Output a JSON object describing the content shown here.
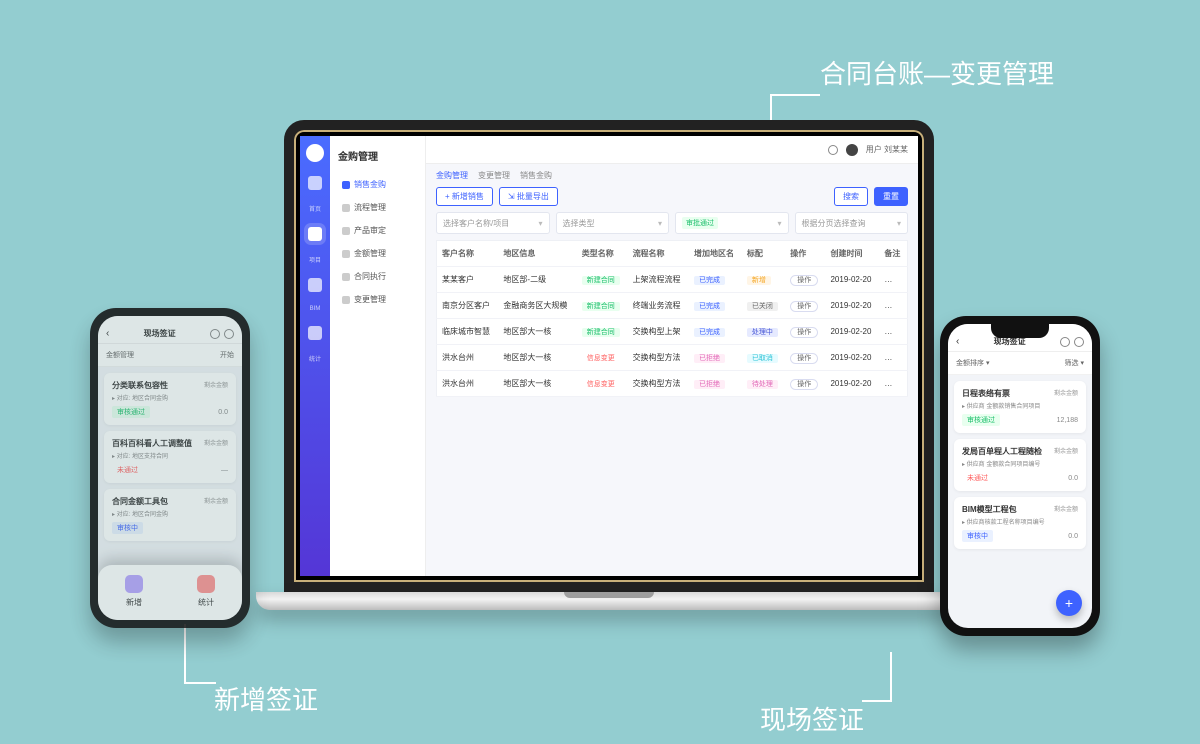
{
  "callouts": {
    "top": "合同台账—变更管理",
    "bottom_left": "新增签证",
    "bottom_right": "现场签证"
  },
  "laptop": {
    "page_title": "金购管理",
    "user_name": "用户 刘某某",
    "iconbar": [
      "首页",
      "项目",
      "BIM",
      "统计"
    ],
    "sidenav": [
      {
        "label": "销售金购",
        "active": true
      },
      {
        "label": "流程管理"
      },
      {
        "label": "产品审定"
      },
      {
        "label": "金额管理"
      },
      {
        "label": "合同执行"
      },
      {
        "label": "变更管理"
      }
    ],
    "crumbs": {
      "a": "金购管理",
      "b": "变更管理",
      "c": "销售金购"
    },
    "actions": {
      "new": "+ 新增销售",
      "export": "⇲ 批量导出",
      "search": "搜索",
      "reset": "重置"
    },
    "filters": {
      "f1": "选择客户名称/项目",
      "f2": "选择类型",
      "f3_badge": "审批通过",
      "f4": "根据分页选择查询"
    },
    "columns": [
      "客户名称",
      "地区信息",
      "类型名称",
      "流程名称",
      "增加地区名",
      "标配",
      "操作",
      "创建时间",
      "备注"
    ],
    "rows": [
      {
        "c0": "某某客户",
        "c1": "地区部-二级",
        "type": {
          "t": "新建合同",
          "cls": "green"
        },
        "c3": "上架流程流程",
        "stat": {
          "t": "已完成",
          "cls": "blue"
        },
        "st2": {
          "t": "新增",
          "cls": "orange"
        },
        "op": "操作",
        "time": "2019-02-20"
      },
      {
        "c0": "南京分区客户",
        "c1": "金融商务区大规模",
        "type": {
          "t": "新建合同",
          "cls": "green"
        },
        "c3": "终端业务流程",
        "stat": {
          "t": "已完成",
          "cls": "blue"
        },
        "st2": {
          "t": "已关闭",
          "cls": "gray"
        },
        "op": "操作",
        "time": "2019-02-20"
      },
      {
        "c0": "临床城市智慧",
        "c1": "地区部大一核",
        "type": {
          "t": "新建合同",
          "cls": "green"
        },
        "c3": "交换构型上架",
        "stat": {
          "t": "已完成",
          "cls": "blue"
        },
        "st2": {
          "t": "处理中",
          "cls": "deepblue"
        },
        "op": "操作",
        "time": "2019-02-20"
      },
      {
        "c0": "洪水台州",
        "c1": "地区部大一核",
        "type": {
          "t": "信息变更",
          "cls": "red"
        },
        "c3": "交换构型方法",
        "stat": {
          "t": "已拒绝",
          "cls": "pink"
        },
        "st2": {
          "t": "已取消",
          "cls": "teal"
        },
        "op": "操作",
        "time": "2019-02-20"
      },
      {
        "c0": "洪水台州",
        "c1": "地区部大一核",
        "type": {
          "t": "信息变更",
          "cls": "red"
        },
        "c3": "交换构型方法",
        "stat": {
          "t": "已拒绝",
          "cls": "pink"
        },
        "st2": {
          "t": "待处理",
          "cls": "pink"
        },
        "op": "操作",
        "time": "2019-02-20"
      }
    ]
  },
  "phone_left": {
    "title": "现场签证",
    "icons": {
      "settings": "⚙",
      "more": "⋯"
    },
    "sub_l": "金额管理",
    "sub_r": "开始",
    "cards": [
      {
        "title": "分类联系包容性",
        "meta": "▸ 对应: 地区合同金购",
        "right": "剩余金额",
        "badge": {
          "t": "审核通过",
          "cls": "green"
        },
        "amt": "0.0"
      },
      {
        "title": "百科百科看人工调整值",
        "meta": "▸ 对应: 地区支持合同",
        "right": "剩余金额",
        "badge": {
          "t": "未通过",
          "cls": "red"
        },
        "amt": "—"
      },
      {
        "title": "合同金额工具包",
        "meta": "▸ 对应: 地区合同金购",
        "right": "剩余金额",
        "badge": {
          "t": "审核中",
          "cls": "blue"
        },
        "amt": ""
      }
    ],
    "sheet": {
      "a": "新增",
      "b": "统计"
    }
  },
  "phone_right": {
    "title": "现场签证",
    "sub_l": "金额排序 ▾",
    "sub_r": "筛选 ▾",
    "cards": [
      {
        "title": "日程表络有票",
        "meta": "▸ 供应商 金额款销售合同项目",
        "right": "剩余金额",
        "badge": {
          "t": "审核通过",
          "cls": "green"
        },
        "amt": "12,188"
      },
      {
        "title": "发局百单程人工程随检",
        "meta": "▸ 供应商 金额款合同项目编号",
        "right": "剩余金额",
        "badge": {
          "t": "未通过",
          "cls": "red"
        },
        "amt": "0.0"
      },
      {
        "title": "BIM模型工程包",
        "meta": "▸ 供应商核款工程名称项目编号",
        "right": "剩余金额",
        "badge": {
          "t": "审核中",
          "cls": "blue"
        },
        "amt": "0.0"
      }
    ],
    "fab": "+"
  }
}
